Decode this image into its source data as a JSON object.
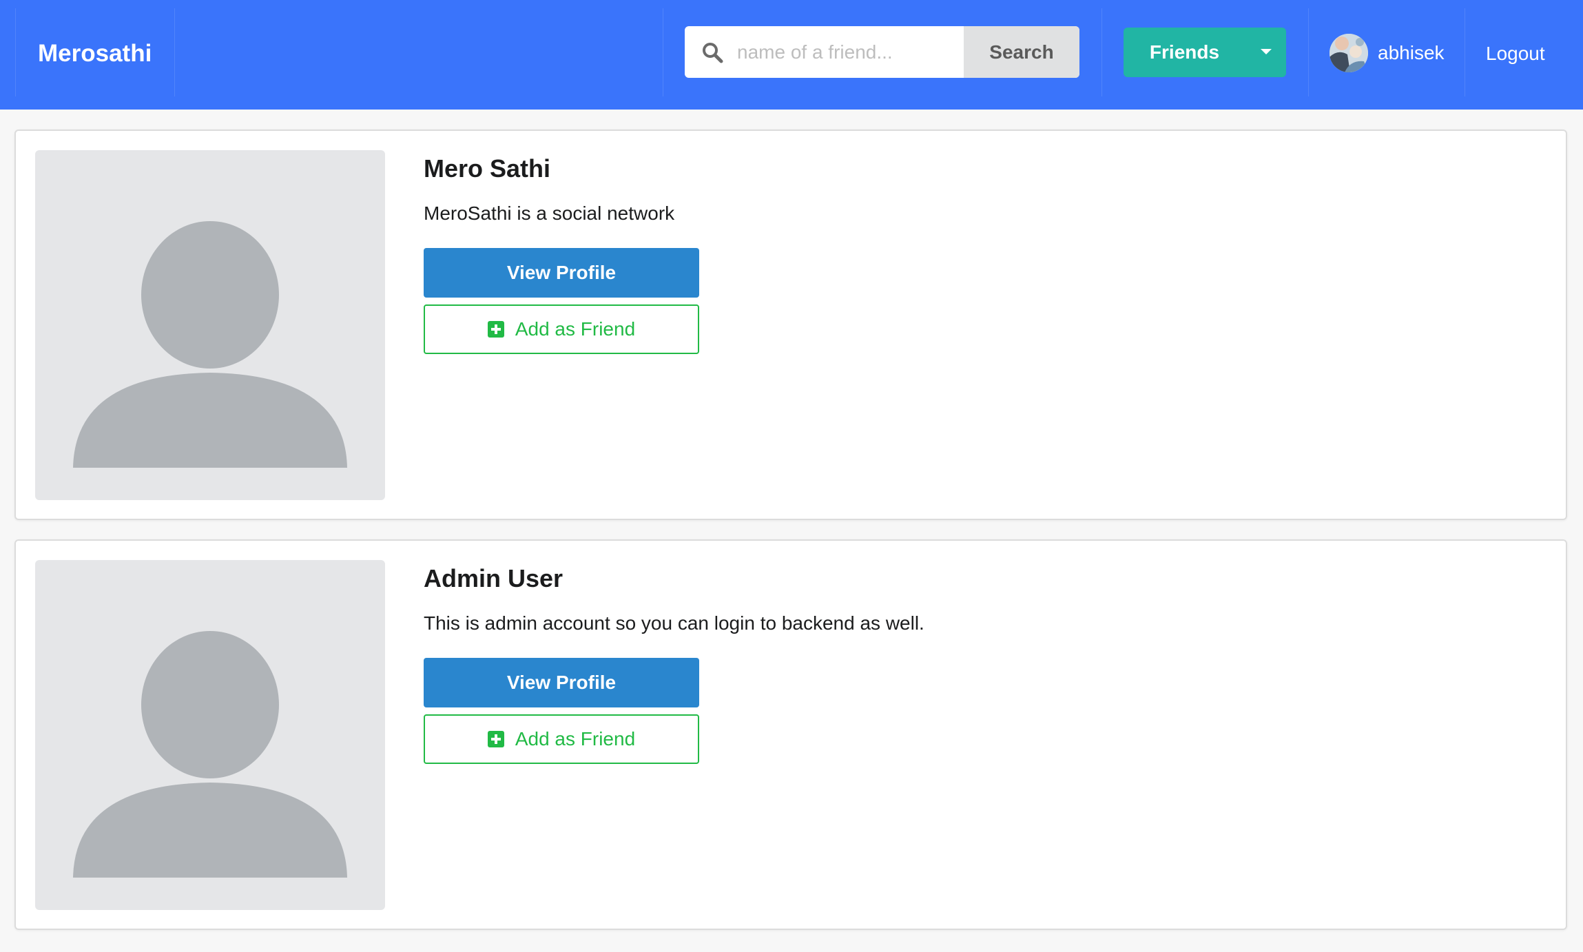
{
  "navbar": {
    "brand": "Merosathi",
    "search": {
      "placeholder": "name of a friend...",
      "value": "",
      "button_label": "Search"
    },
    "friends_label": "Friends",
    "username": "abhisek",
    "logout_label": "Logout"
  },
  "results": [
    {
      "name": "Mero Sathi",
      "description": "MeroSathi is a social network",
      "view_profile_label": "View Profile",
      "add_friend_label": "Add as Friend"
    },
    {
      "name": "Admin User",
      "description": "This is admin account so you can login to backend as well.",
      "view_profile_label": "View Profile",
      "add_friend_label": "Add as Friend"
    }
  ],
  "colors": {
    "navbar_bg": "#3a74fb",
    "friends_button": "#21b5a4",
    "view_profile_button": "#2a86ce",
    "add_friend_accent": "#21ba45",
    "placeholder_bg": "#e5e6e8",
    "placeholder_figure": "#b0b4b8"
  },
  "icons": {
    "search": "search-icon",
    "dropdown": "caret-down-icon",
    "add_friend": "plus-square-icon",
    "profile_placeholder": "user-silhouette-icon"
  }
}
